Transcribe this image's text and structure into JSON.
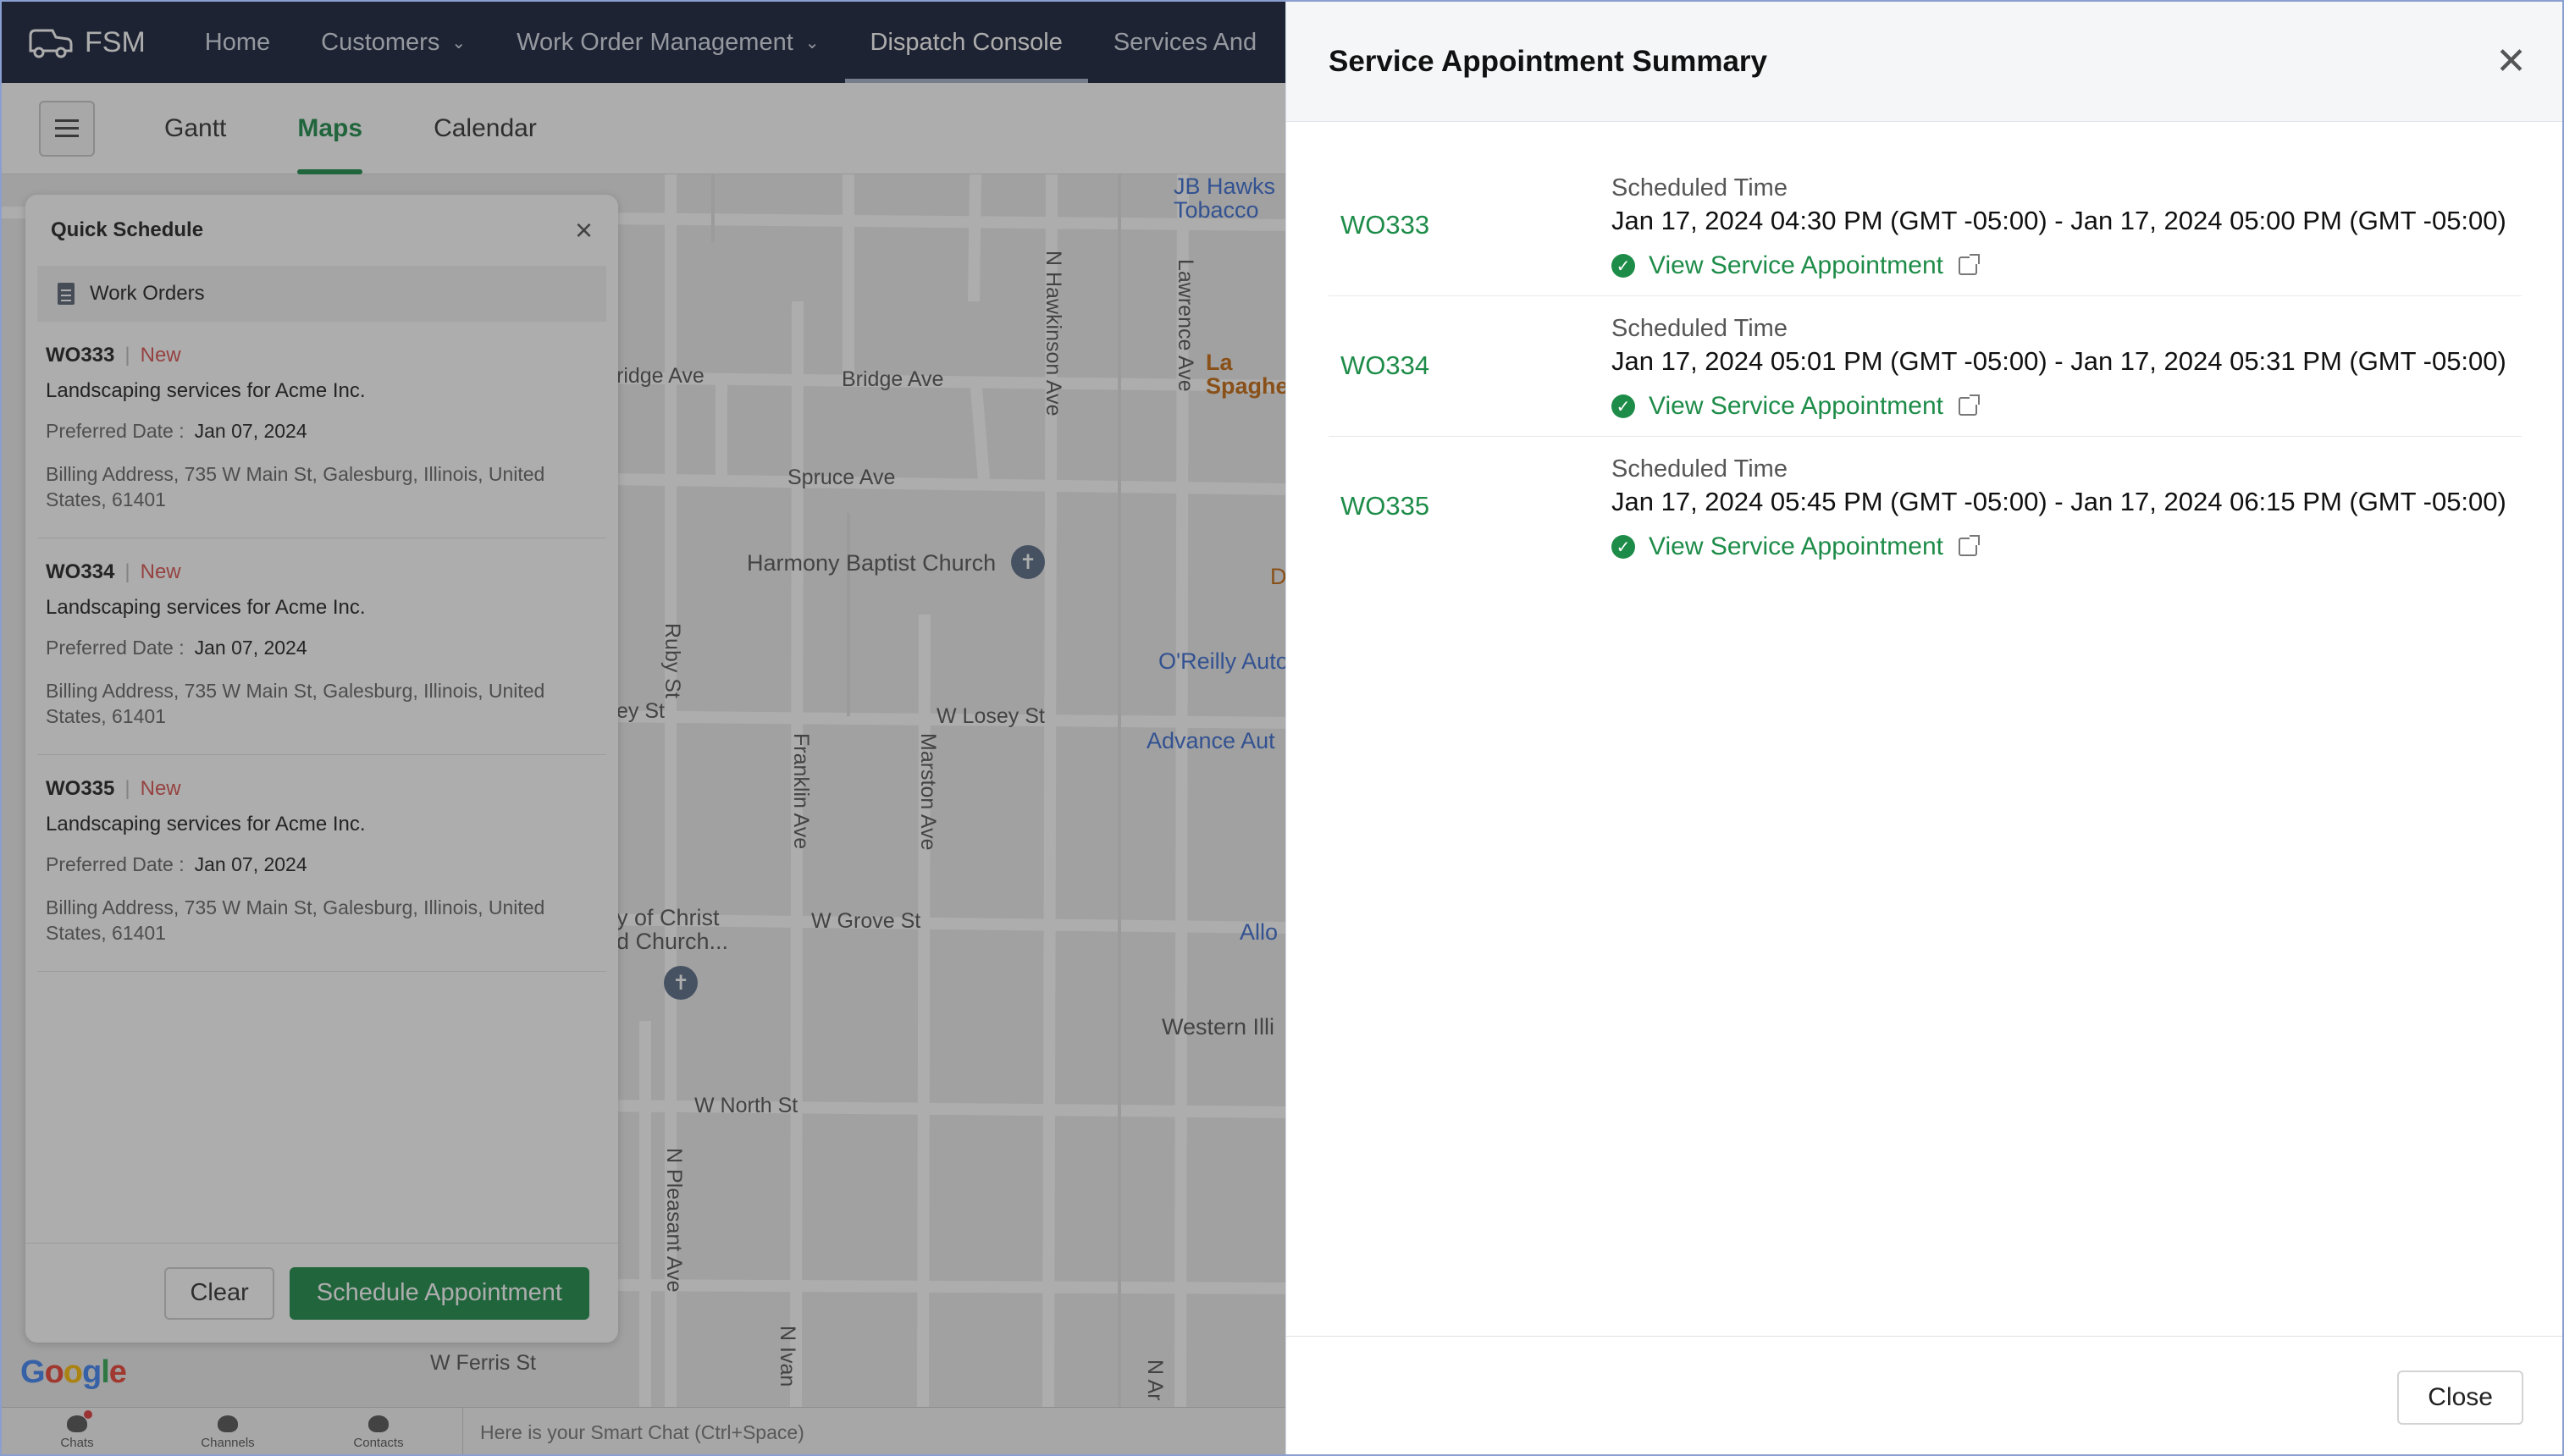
{
  "app": {
    "name": "FSM",
    "logo_icon": "truck-icon"
  },
  "nav": {
    "items": [
      {
        "label": "Home",
        "dropdown": false
      },
      {
        "label": "Customers",
        "dropdown": true
      },
      {
        "label": "Work Order Management",
        "dropdown": true
      },
      {
        "label": "Dispatch Console",
        "dropdown": false,
        "active": true
      },
      {
        "label": "Services And",
        "dropdown": false
      }
    ]
  },
  "tabs": [
    "Gantt",
    "Maps",
    "Calendar"
  ],
  "active_tab": "Maps",
  "map": {
    "streets": [
      "Bridge Ave",
      "ridge Ave",
      "Spruce Ave",
      "W Losey St",
      "ey St",
      "W Grove St",
      "W North St",
      "W Ferris St",
      "Ruby St",
      "Franklin Ave",
      "Marston Ave",
      "N Hawkinson Ave",
      "Lawrence Ave",
      "N Pleasant Ave",
      "N Ivan",
      "N Ar"
    ],
    "places": [
      "Harmony Baptist Church",
      "JB Hawks Tobacco",
      "O'Reilly Auto",
      "Advance Aut",
      "Allo",
      "Western Illi",
      "y of Christ d Church...",
      "La Spaghe",
      "D"
    ],
    "attribution": "Google"
  },
  "quick_schedule": {
    "title": "Quick Schedule",
    "section": "Work Orders",
    "preferred_label": "Preferred Date :",
    "items": [
      {
        "id": "WO333",
        "status": "New",
        "desc": "Landscaping services for Acme Inc.",
        "preferred_date": "Jan 07, 2024",
        "address": "Billing Address, 735 W Main St, Galesburg, Illinois, United States, 61401"
      },
      {
        "id": "WO334",
        "status": "New",
        "desc": "Landscaping services for Acme Inc.",
        "preferred_date": "Jan 07, 2024",
        "address": "Billing Address, 735 W Main St, Galesburg, Illinois, United States, 61401"
      },
      {
        "id": "WO335",
        "status": "New",
        "desc": "Landscaping services for Acme Inc.",
        "preferred_date": "Jan 07, 2024",
        "address": "Billing Address, 735 W Main St, Galesburg, Illinois, United States, 61401"
      }
    ],
    "clear_label": "Clear",
    "schedule_label": "Schedule Appointment"
  },
  "chatbar": {
    "items": [
      "Chats",
      "Channels",
      "Contacts"
    ],
    "smart_chat": "Here is your Smart Chat (Ctrl+Space)"
  },
  "modal": {
    "title": "Service Appointment Summary",
    "scheduled_label": "Scheduled Time",
    "view_label": "View Service Appointment",
    "rows": [
      {
        "wo": "WO333",
        "time": "Jan 17, 2024 04:30 PM (GMT -05:00) - Jan 17, 2024 05:00 PM (GMT -05:00)"
      },
      {
        "wo": "WO334",
        "time": "Jan 17, 2024 05:01 PM (GMT -05:00) - Jan 17, 2024 05:31 PM (GMT -05:00)"
      },
      {
        "wo": "WO335",
        "time": "Jan 17, 2024 05:45 PM (GMT -05:00) - Jan 17, 2024 06:15 PM (GMT -05:00)"
      }
    ],
    "close_label": "Close"
  },
  "colors": {
    "accent": "#1e8c49",
    "nav_bg": "#17213a",
    "status_new": "#d9534f",
    "link_blue": "#3a6cd2"
  }
}
